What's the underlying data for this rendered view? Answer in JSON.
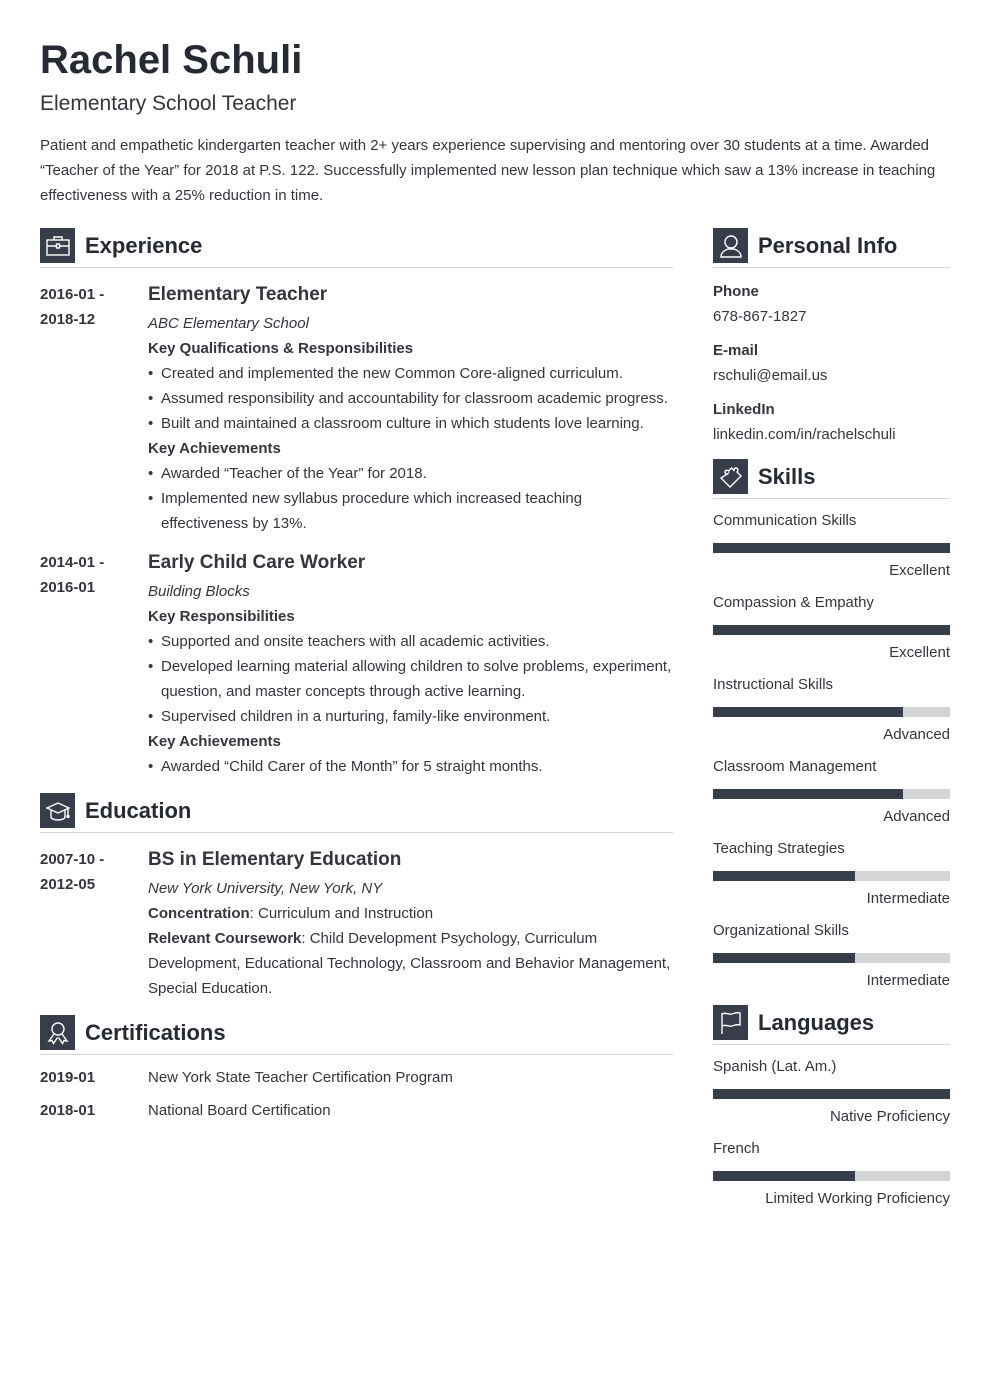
{
  "header": {
    "name": "Rachel Schuli",
    "title": "Elementary School Teacher",
    "summary": "Patient and empathetic kindergarten teacher with 2+ years experience supervising and mentoring over 30 students at a time. Awarded “Teacher of the Year” for 2018 at P.S. 122. Successfully implemented new lesson plan technique which saw a 13% increase in teaching effectiveness with a 25% reduction in time."
  },
  "experience": {
    "heading": "Experience",
    "icon": "briefcase-icon",
    "items": [
      {
        "date_start": "2016-01 -",
        "date_end": "2018-12",
        "role": "Elementary Teacher",
        "company": "ABC Elementary School",
        "groups": [
          {
            "label": "Key Qualifications & Responsibilities",
            "bullets": [
              "Created and implemented the new Common Core-aligned curriculum.",
              "Assumed responsibility and accountability for classroom academic progress.",
              "Built and maintained a classroom culture in which students love learning."
            ]
          },
          {
            "label": "Key Achievements",
            "bullets": [
              "Awarded “Teacher of the Year” for 2018.",
              "Implemented new syllabus procedure which increased teaching effectiveness by 13%."
            ]
          }
        ]
      },
      {
        "date_start": "2014-01 -",
        "date_end": "2016-01",
        "role": "Early Child Care Worker",
        "company": "Building Blocks",
        "groups": [
          {
            "label": "Key Responsibilities",
            "bullets": [
              "Supported and onsite teachers with all academic activities.",
              "Developed learning material allowing children to solve problems, experiment, question, and master concepts through active learning.",
              "Supervised children in a nurturing, family-like environment."
            ]
          },
          {
            "label": "Key Achievements",
            "bullets": [
              "Awarded “Child Carer of the Month” for 5 straight months."
            ]
          }
        ]
      }
    ]
  },
  "education": {
    "heading": "Education",
    "icon": "graduation-cap-icon",
    "date_start": "2007-10 -",
    "date_end": "2012-05",
    "degree": "BS in Elementary Education",
    "school": "New York University, New York, NY",
    "concentration_label": "Concentration",
    "concentration": ": Curriculum and Instruction",
    "coursework_label": "Relevant Coursework",
    "coursework": ": Child Development Psychology, Curriculum Development, Educational Technology, Classroom and Behavior Management, Special Education."
  },
  "certifications": {
    "heading": "Certifications",
    "icon": "award-ribbon-icon",
    "items": [
      {
        "date": "2019-01",
        "name": "New York State Teacher Certification Program"
      },
      {
        "date": "2018-01",
        "name": "National Board Certification"
      }
    ]
  },
  "personal": {
    "heading": "Personal Info",
    "icon": "user-icon",
    "fields": [
      {
        "label": "Phone",
        "value": "678-867-1827"
      },
      {
        "label": "E-mail",
        "value": "rschuli@email.us"
      },
      {
        "label": "LinkedIn",
        "value": "linkedin.com/in/rachelschuli"
      }
    ]
  },
  "skills": {
    "heading": "Skills",
    "icon": "puzzle-piece-icon",
    "items": [
      {
        "name": "Communication Skills",
        "level": "Excellent",
        "fraction": 1.0
      },
      {
        "name": "Compassion & Empathy",
        "level": "Excellent",
        "fraction": 1.0
      },
      {
        "name": "Instructional Skills",
        "level": "Advanced",
        "fraction": 0.8
      },
      {
        "name": "Classroom Management",
        "level": "Advanced",
        "fraction": 0.8
      },
      {
        "name": "Teaching Strategies",
        "level": "Intermediate",
        "fraction": 0.6
      },
      {
        "name": "Organizational Skills",
        "level": "Intermediate",
        "fraction": 0.6
      }
    ]
  },
  "languages": {
    "heading": "Languages",
    "icon": "flag-icon",
    "items": [
      {
        "name": "Spanish (Lat. Am.)",
        "level": "Native Proficiency",
        "fraction": 1.0
      },
      {
        "name": "French",
        "level": "Limited Working Proficiency",
        "fraction": 0.6
      }
    ]
  },
  "colors": {
    "accent": "#373d4a",
    "bar_track": "#d4d5d6",
    "text": "#33363d"
  }
}
